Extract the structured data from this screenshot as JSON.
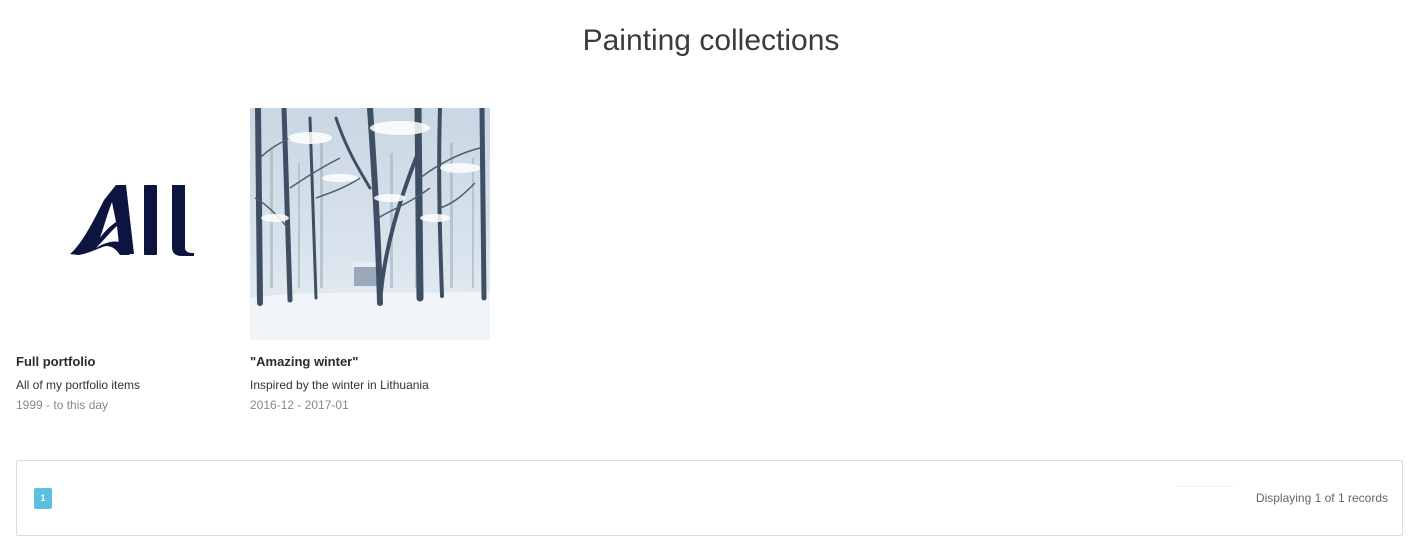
{
  "page": {
    "title": "Painting collections"
  },
  "collections": [
    {
      "title": "Full portfolio",
      "description": "All of my portfolio items",
      "dates": "1999 - to this day",
      "thumbnail": "all-logo",
      "logo_text": "All",
      "logo_color": "#0d1442"
    },
    {
      "title": "\"Amazing winter\"",
      "description": "Inspired by the winter in Lithuania",
      "dates": "2016-12 - 2017-01",
      "thumbnail": "snowy-forest-painting"
    }
  ],
  "pagination": {
    "current_page": "1",
    "accent": "#5bc0de",
    "records_label": "Displaying 1 of 1 records"
  }
}
